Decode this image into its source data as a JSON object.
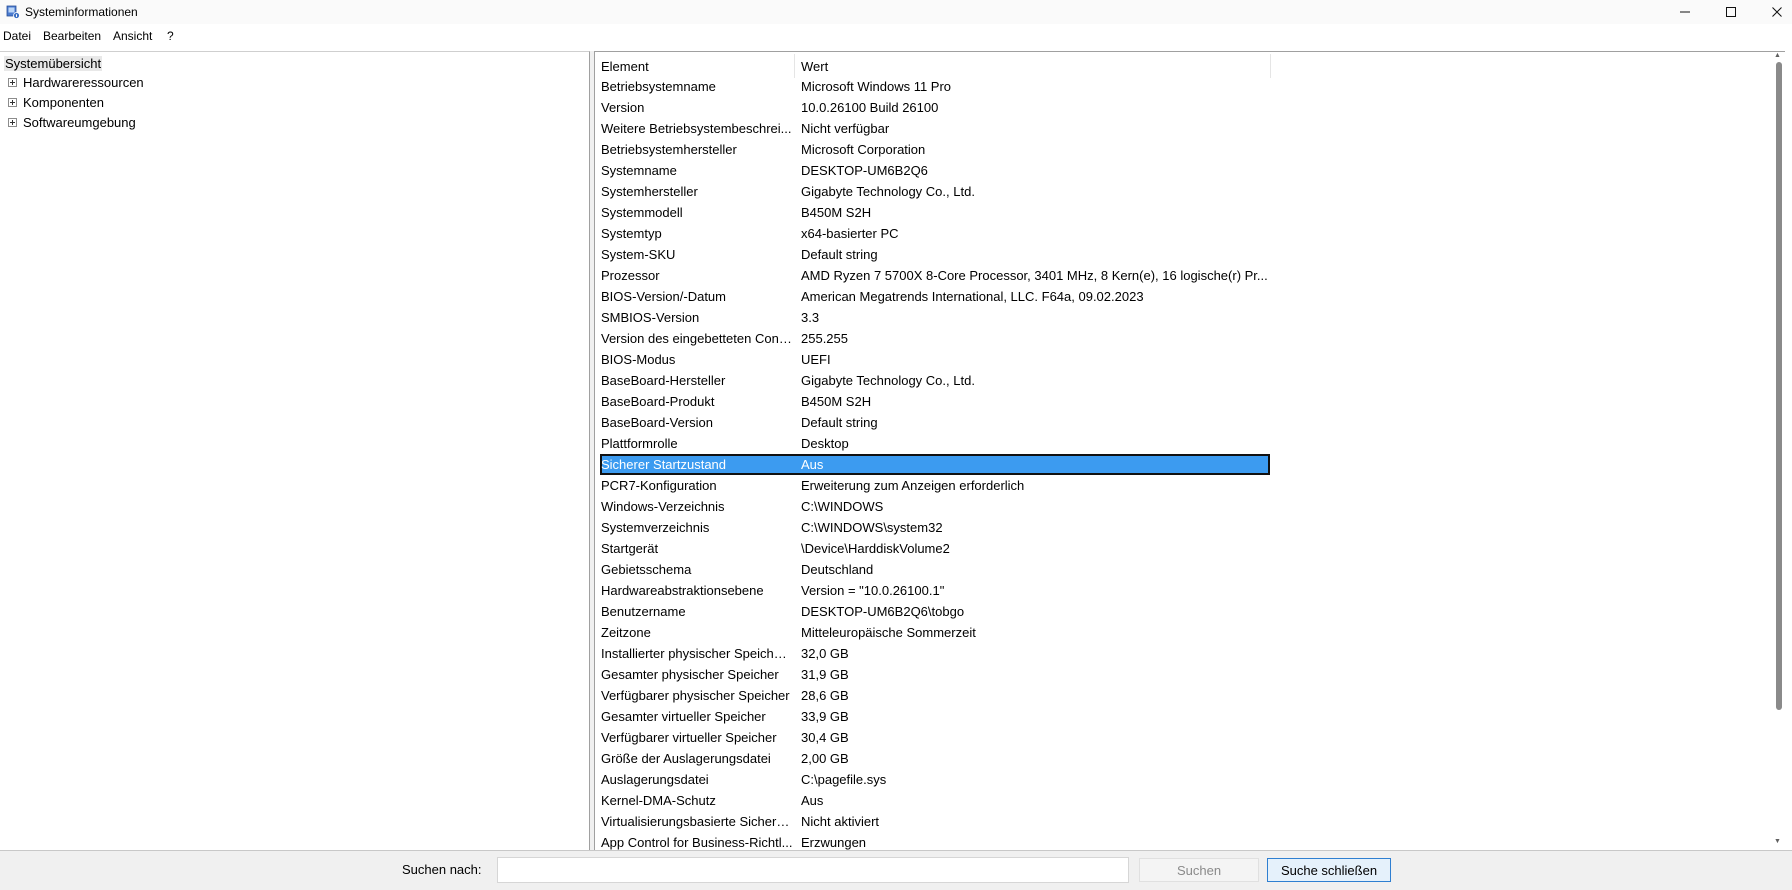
{
  "window": {
    "title": "Systeminformationen"
  },
  "menu": [
    "Datei",
    "Bearbeiten",
    "Ansicht",
    "?"
  ],
  "tree": {
    "root": "Systemübersicht",
    "nodes": [
      "Hardwareressourcen",
      "Komponenten",
      "Softwareumgebung"
    ]
  },
  "list": {
    "columns": [
      "Element",
      "Wert"
    ],
    "rows": [
      [
        "Betriebsystemname",
        "Microsoft Windows 11 Pro"
      ],
      [
        "Version",
        "10.0.26100 Build 26100"
      ],
      [
        "Weitere Betriebsystembeschrei...",
        "Nicht verfügbar"
      ],
      [
        "Betriebsystemhersteller",
        "Microsoft Corporation"
      ],
      [
        "Systemname",
        "DESKTOP-UM6B2Q6"
      ],
      [
        "Systemhersteller",
        "Gigabyte Technology Co., Ltd."
      ],
      [
        "Systemmodell",
        "B450M S2H"
      ],
      [
        "Systemtyp",
        "x64-basierter PC"
      ],
      [
        "System-SKU",
        "Default string"
      ],
      [
        "Prozessor",
        "AMD Ryzen 7 5700X 8-Core Processor, 3401 MHz, 8 Kern(e), 16 logische(r) Pr..."
      ],
      [
        "BIOS-Version/-Datum",
        "American Megatrends International, LLC. F64a, 09.02.2023"
      ],
      [
        "SMBIOS-Version",
        "3.3"
      ],
      [
        "Version des eingebetteten Cont...",
        "255.255"
      ],
      [
        "BIOS-Modus",
        "UEFI"
      ],
      [
        "BaseBoard-Hersteller",
        "Gigabyte Technology Co., Ltd."
      ],
      [
        "BaseBoard-Produkt",
        "B450M S2H"
      ],
      [
        "BaseBoard-Version",
        "Default string"
      ],
      [
        "Plattformrolle",
        "Desktop"
      ],
      [
        "Sicherer Startzustand",
        "Aus"
      ],
      [
        "PCR7-Konfiguration",
        "Erweiterung zum Anzeigen erforderlich"
      ],
      [
        "Windows-Verzeichnis",
        "C:\\WINDOWS"
      ],
      [
        "Systemverzeichnis",
        "C:\\WINDOWS\\system32"
      ],
      [
        "Startgerät",
        "\\Device\\HarddiskVolume2"
      ],
      [
        "Gebietsschema",
        "Deutschland"
      ],
      [
        "Hardwareabstraktionsebene",
        "Version = \"10.0.26100.1\""
      ],
      [
        "Benutzername",
        "DESKTOP-UM6B2Q6\\tobgo"
      ],
      [
        "Zeitzone",
        "Mitteleuropäische Sommerzeit"
      ],
      [
        "Installierter physischer Speicher...",
        "32,0 GB"
      ],
      [
        "Gesamter physischer Speicher",
        "31,9 GB"
      ],
      [
        "Verfügbarer physischer Speicher",
        "28,6 GB"
      ],
      [
        "Gesamter virtueller Speicher",
        "33,9 GB"
      ],
      [
        "Verfügbarer virtueller Speicher",
        "30,4 GB"
      ],
      [
        "Größe der Auslagerungsdatei",
        "2,00 GB"
      ],
      [
        "Auslagerungsdatei",
        "C:\\pagefile.sys"
      ],
      [
        "Kernel-DMA-Schutz",
        "Aus"
      ],
      [
        "Virtualisierungsbasierte Sicherh...",
        "Nicht aktiviert"
      ],
      [
        "App Control for Business-Richtl...",
        "Erzwungen"
      ]
    ],
    "selected_row": 18,
    "selection_color": "#3c9bf0"
  },
  "search": {
    "label": "Suchen nach:",
    "value": "",
    "search_button": "Suchen",
    "close_button": "Suche schließen"
  }
}
